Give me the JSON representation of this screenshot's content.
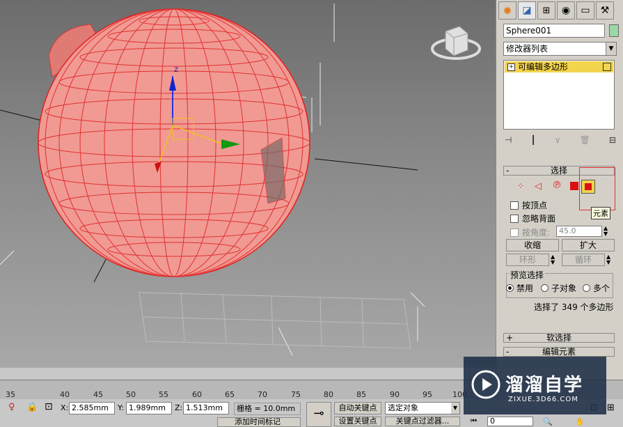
{
  "panel": {
    "object_name": "Sphere001",
    "modifier_list": "修改器列表",
    "stack_item": "可编辑多边形",
    "selection_title": "选择",
    "by_vertex": "按顶点",
    "ignore_backfacing": "忽略背面",
    "by_angle": "按角度:",
    "angle_value": "45.0",
    "shrink": "收缩",
    "grow": "扩大",
    "ring": "环形",
    "loop": "循环",
    "preview_title": "预览选择",
    "preview_disabled": "禁用",
    "preview_subobject": "子对象",
    "preview_multi": "多个",
    "status": "选择了 349 个多边形",
    "soft_selection": "软选择",
    "edit_elements": "编辑元素",
    "tooltip": "元素",
    "minus": "-",
    "plus": "+"
  },
  "viewport": {
    "axis_label": "Z"
  },
  "timeline": {
    "ticks": [
      "35",
      "40",
      "45",
      "50",
      "55",
      "60",
      "65",
      "70",
      "75",
      "80",
      "85",
      "90",
      "95",
      "100"
    ]
  },
  "status": {
    "x_label": "X:",
    "x_value": "2.585mm",
    "y_label": "Y:",
    "y_value": "1.989mm",
    "z_label": "Z:",
    "z_value": "1.513mm",
    "grid": "栅格 = 10.0mm",
    "auto_key": "自动关键点",
    "set_key": "设置关键点",
    "selected_object": "选定对象",
    "key_filter": "关键点过滤器...",
    "add_time_tag": "添加时间标记",
    "frame_value": "0"
  },
  "watermark": {
    "brand": "溜溜自学",
    "url": "ZIXUE.3D66.COM"
  },
  "colors": {
    "selection": "#ff0000",
    "stack_highlight": "#f3d44d",
    "mesh": "#f0908a"
  }
}
